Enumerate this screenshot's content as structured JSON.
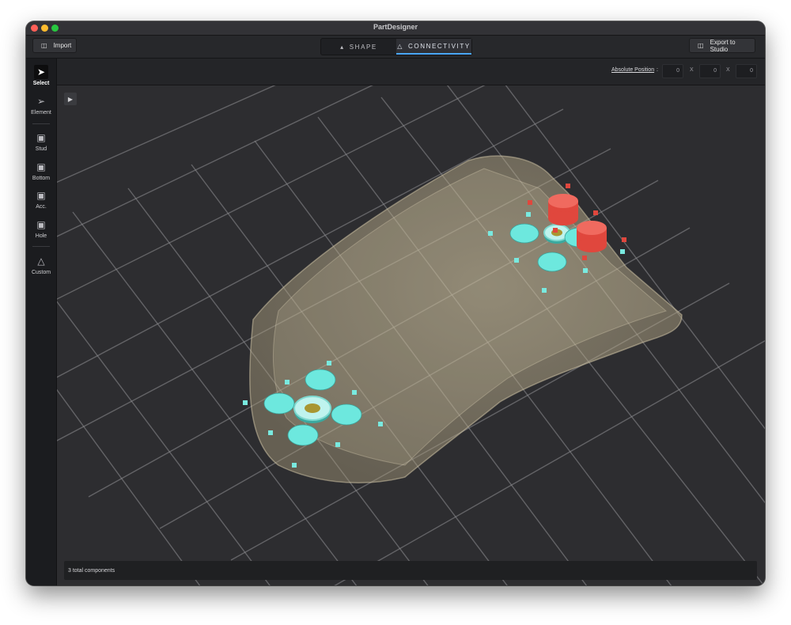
{
  "window": {
    "title": "PartDesigner"
  },
  "toolbar": {
    "import_label": "Import",
    "export_label": "Export to Studio",
    "tabs": [
      {
        "label": "SHAPE",
        "icon": "shapes-icon",
        "active": false
      },
      {
        "label": "CONNECTIVITY",
        "icon": "connectivity-icon",
        "active": true
      }
    ]
  },
  "sidebar": {
    "tools": [
      {
        "label": "Select",
        "icon": "cursor-icon",
        "active": true
      },
      {
        "label": "Element",
        "icon": "pointer-icon",
        "active": false
      },
      {
        "label": "Stud",
        "icon": "stud-cube-icon",
        "active": false
      },
      {
        "label": "Bottom",
        "icon": "bottom-cube-icon",
        "active": false
      },
      {
        "label": "Acc.",
        "icon": "acc-cube-icon",
        "active": false
      },
      {
        "label": "Hole",
        "icon": "hole-cube-icon",
        "active": false
      },
      {
        "label": "Custom",
        "icon": "custom-node-icon",
        "active": false
      }
    ]
  },
  "position": {
    "label": "Absolute Position",
    "x": "0",
    "y": "0",
    "z": "0",
    "sep": "X"
  },
  "viewport": {
    "camera_icon": "camera-icon"
  },
  "status": {
    "text": "3 total components"
  },
  "colors": {
    "connector_cyan": "#6de8de",
    "connector_red": "#e0473d",
    "shell": "#c9bc9a",
    "accent_blue": "#4aa7ff"
  }
}
